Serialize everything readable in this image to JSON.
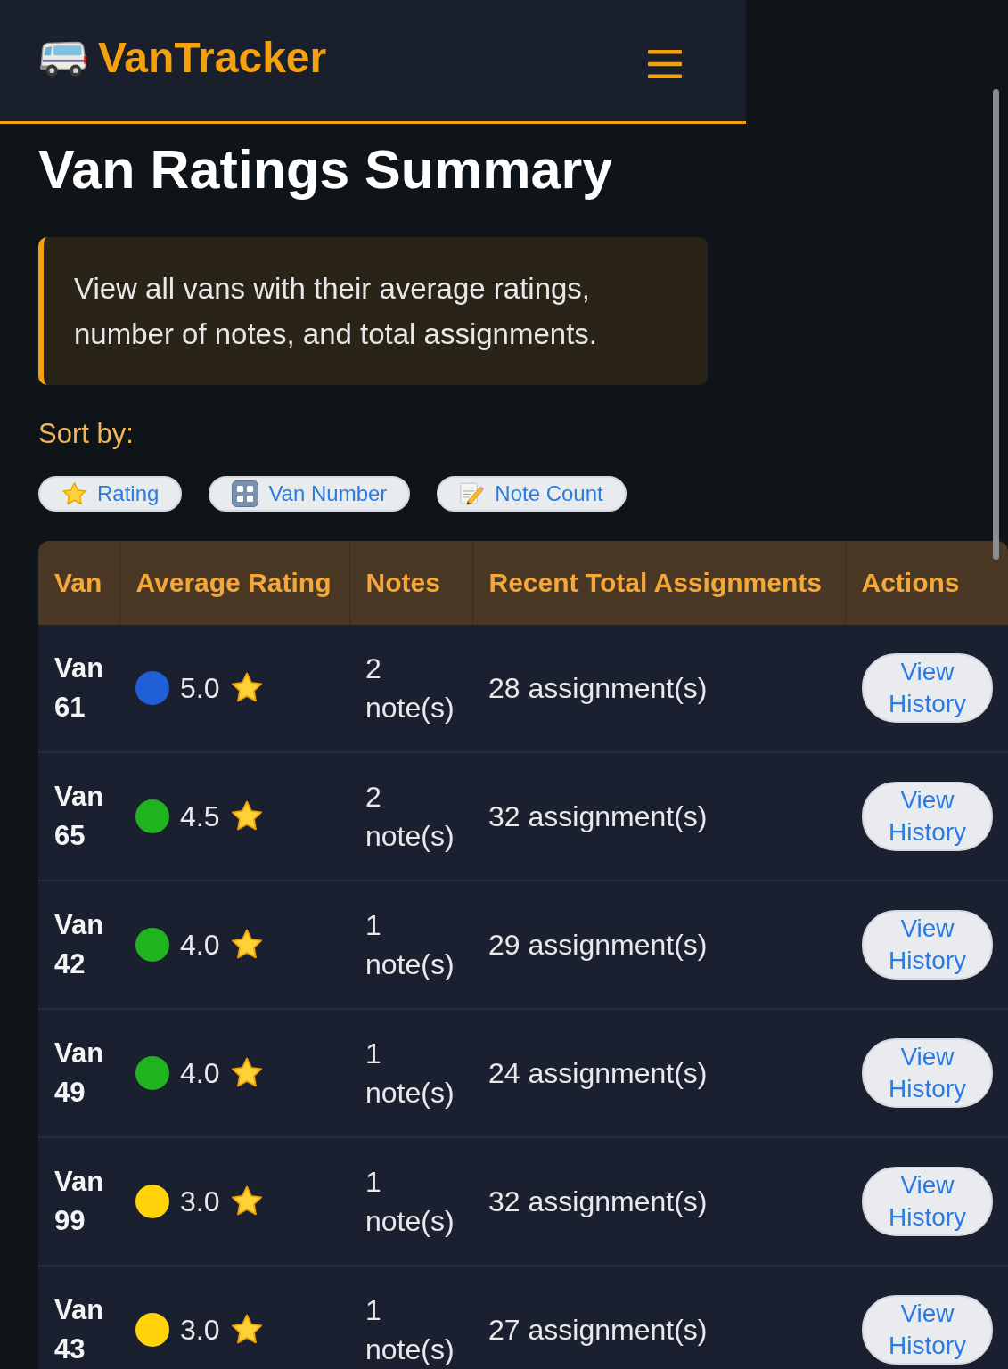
{
  "navbar": {
    "brand": "VanTracker"
  },
  "page_title": "Van Ratings Summary",
  "info_box": {
    "text": "View all vans with their average ratings, number of notes, and total assignments."
  },
  "sort": {
    "label": "Sort by:",
    "options": [
      {
        "label": "Rating",
        "kind": "star"
      },
      {
        "label": "Van Number",
        "kind": "numbers"
      },
      {
        "label": "Note Count",
        "kind": "memo"
      }
    ]
  },
  "table": {
    "columns": [
      "Van",
      "Average Rating",
      "Notes",
      "Recent Total Assignments",
      "Actions"
    ],
    "rows": [
      {
        "van": "Van 61",
        "color": "#1f5fd8",
        "rating": "5.0",
        "notes": "2 note(s)",
        "assignments": "28 assignment(s)",
        "action": "View History"
      },
      {
        "van": "Van 65",
        "color": "#1fb41f",
        "rating": "4.5",
        "notes": "2 note(s)",
        "assignments": "32 assignment(s)",
        "action": "View History"
      },
      {
        "van": "Van 42",
        "color": "#1fb41f",
        "rating": "4.0",
        "notes": "1 note(s)",
        "assignments": "29 assignment(s)",
        "action": "View History"
      },
      {
        "van": "Van 49",
        "color": "#1fb41f",
        "rating": "4.0",
        "notes": "1 note(s)",
        "assignments": "24 assignment(s)",
        "action": "View History"
      },
      {
        "van": "Van 99",
        "color": "#ffd20a",
        "rating": "3.0",
        "notes": "1 note(s)",
        "assignments": "32 assignment(s)",
        "action": "View History"
      },
      {
        "van": "Van 43",
        "color": "#ffd20a",
        "rating": "3.0",
        "notes": "1 note(s)",
        "assignments": "27 assignment(s)",
        "action": "View History"
      }
    ]
  }
}
